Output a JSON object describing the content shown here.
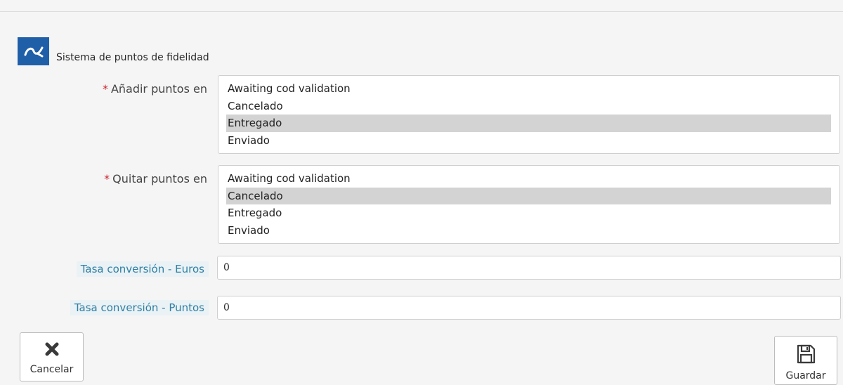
{
  "module": {
    "title": "Sistema de puntos de fidelidad",
    "logo_icon": "prestashop-logo-icon"
  },
  "add_points": {
    "label": "Añadir puntos en",
    "required_marker": "*",
    "options": [
      "Awaiting cod validation",
      "Cancelado",
      "Entregado",
      "Enviado"
    ],
    "selected": "Entregado"
  },
  "remove_points": {
    "label": "Quitar puntos en",
    "required_marker": "*",
    "options": [
      "Awaiting cod validation",
      "Cancelado",
      "Entregado",
      "Enviado"
    ],
    "selected": "Cancelado"
  },
  "euros_rate": {
    "label": "Tasa conversión - Euros",
    "value": "0"
  },
  "points_rate": {
    "label": "Tasa conversión - Puntos",
    "value": "0"
  },
  "buttons": {
    "cancel_label": "Cancelar",
    "cancel_icon": "close-icon",
    "save_label": "Guardar",
    "save_icon": "floppy-disk-icon"
  },
  "colors": {
    "logo_bg": "#1f5fa8",
    "required": "#c8232a",
    "label_link": "#2f7fa4",
    "selected_option_bg": "#d3d3d3"
  }
}
